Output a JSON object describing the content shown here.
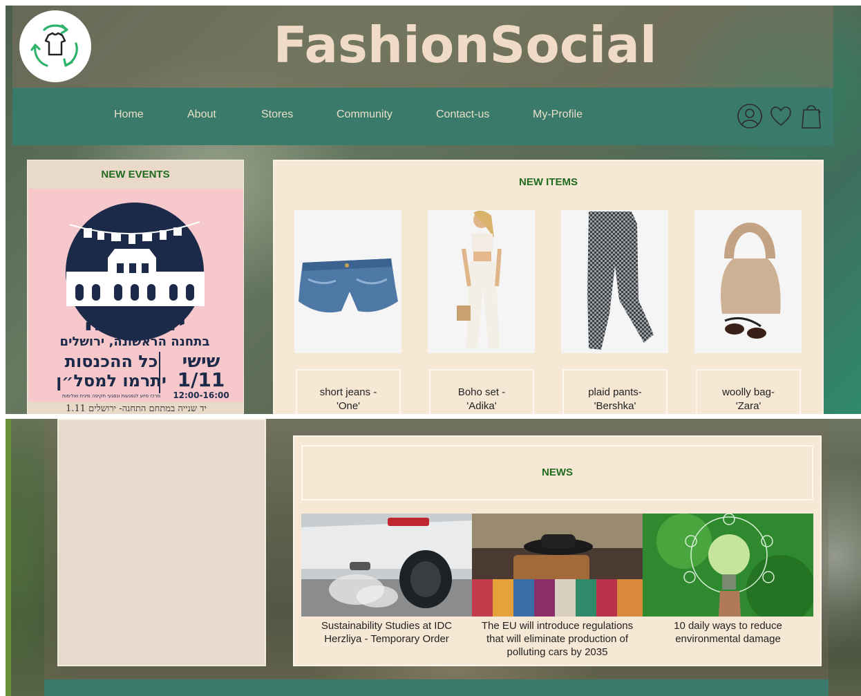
{
  "site": {
    "title": "FashionSocial",
    "logo_icon": "recycle-shirt-icon"
  },
  "nav": {
    "links": [
      "Home",
      "About",
      "Stores",
      "Community",
      "Contact-us",
      "My-Profile"
    ],
    "icons": [
      "user-icon",
      "heart-icon",
      "shopping-bag-icon"
    ]
  },
  "events": {
    "title": "NEW EVENTS",
    "poster": {
      "name": "יד שנייה",
      "location": "בתחנה הראשונה, ירושלים",
      "day": "שישי",
      "date": "1/11",
      "time": "12:00-16:00",
      "headline_1": "כל ההכנסות",
      "headline_2": "יתרמו למסל״ן",
      "small_text": "מרכז סיוע לנפגעות ונפגעי תקיפה מינית ואלימות",
      "caption": "1.11 יד שנייה במתחם התחנה- ירושלים"
    }
  },
  "items": {
    "title": "NEW ITEMS",
    "list": [
      {
        "label_line1": "short jeans -",
        "label_line2": "'One'"
      },
      {
        "label_line1": "Boho set -",
        "label_line2": "'Adika'"
      },
      {
        "label_line1": "plaid pants-",
        "label_line2": "'Bershka'"
      },
      {
        "label_line1": "woolly bag-",
        "label_line2": "'Zara'"
      }
    ]
  },
  "news": {
    "title": "NEWS",
    "articles": [
      {
        "line1": "Sustainability Studies at IDC",
        "line2": "Herzliya - Temporary Order",
        "line3": ""
      },
      {
        "line1": "The EU will introduce regulations",
        "line2": "that will eliminate production of",
        "line3": "polluting cars by 2035"
      },
      {
        "line1": "10 daily ways to reduce",
        "line2": "environmental damage",
        "line3": ""
      }
    ]
  },
  "colors": {
    "nav_bg": "#3a7a6a",
    "panel_bg": "#f7e8d5",
    "section_title": "#1f6b1f",
    "site_title": "#f0dcc6",
    "poster_bg": "#f6c8cb",
    "poster_navy": "#1c2a4a"
  }
}
